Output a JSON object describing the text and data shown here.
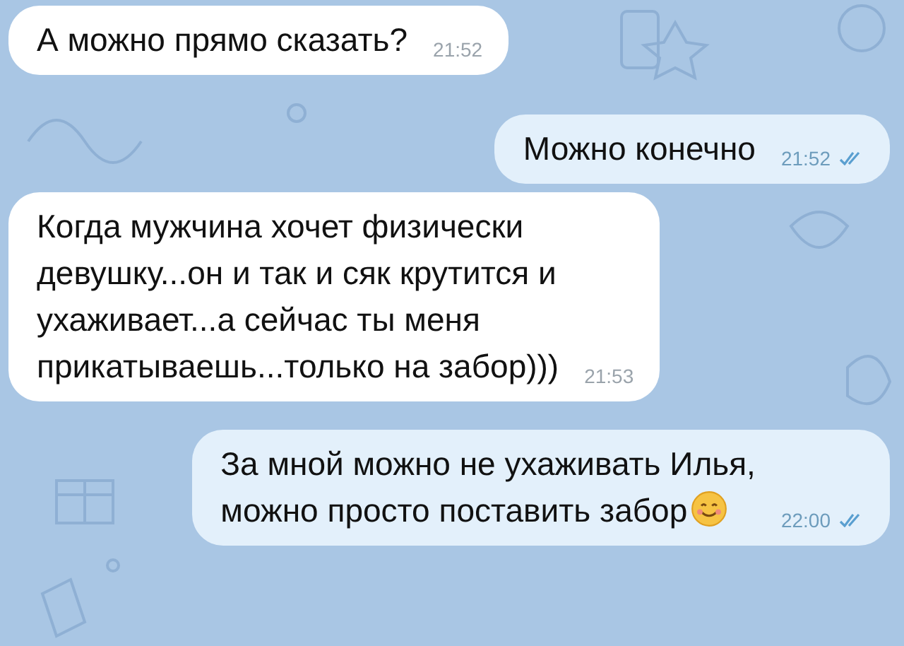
{
  "messages": [
    {
      "kind": "incoming",
      "lines": [
        "А можно прямо сказать?"
      ],
      "time": "21:52",
      "read": false,
      "emoji": false
    },
    {
      "kind": "outgoing",
      "lines": [
        "Можно конечно"
      ],
      "time": "21:52",
      "read": true,
      "emoji": false
    },
    {
      "kind": "incoming",
      "lines": [
        "Когда мужчина хочет физически",
        "девушку...он и так и сяк крутится и",
        "ухаживает...а сейчас ты меня",
        "прикатываешь...только на забор)))"
      ],
      "time": "21:53",
      "read": false,
      "emoji": false
    },
    {
      "kind": "outgoing",
      "lines": [
        "За мной можно не ухаживать Илья,",
        "можно просто поставить забор"
      ],
      "time": "22:00",
      "read": true,
      "emoji": true
    }
  ]
}
